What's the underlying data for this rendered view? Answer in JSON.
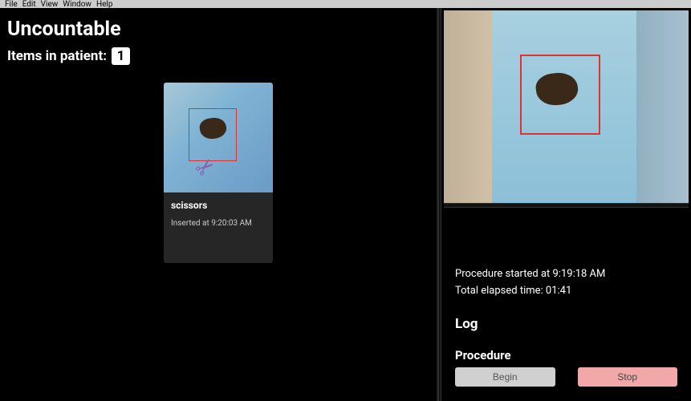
{
  "menubar": {
    "file": "File",
    "edit": "Edit",
    "view": "View",
    "window": "Window",
    "help": "Help"
  },
  "left": {
    "title": "Uncountable",
    "items_label": "Items in patient:",
    "count": "1",
    "card": {
      "title": "scissors",
      "detail": "Inserted at 9:20:03 AM"
    }
  },
  "right": {
    "proc_started": "Procedure started at 9:19:18 AM",
    "elapsed": "Total elapsed time: 01:41",
    "log_heading": "Log",
    "proc_heading": "Procedure",
    "begin": "Begin",
    "stop": "Stop"
  }
}
